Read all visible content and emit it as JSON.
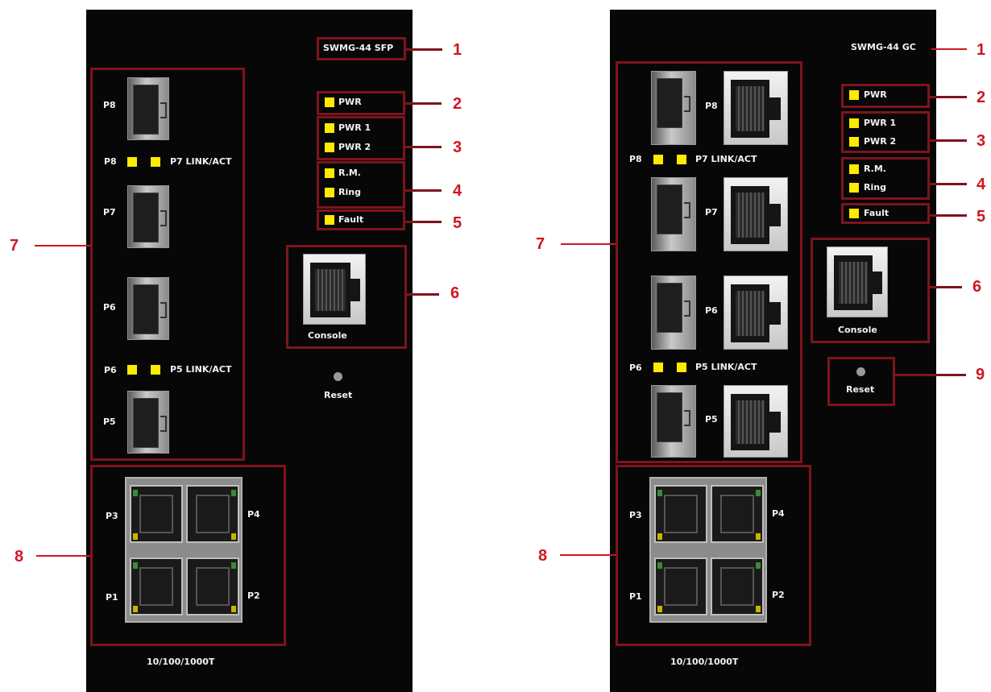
{
  "left_panel": {
    "model": "SWMG-44 SFP",
    "leds": {
      "pwr": "PWR",
      "pwr1": "PWR 1",
      "pwr2": "PWR 2",
      "rm": "R.M.",
      "ring": "Ring",
      "fault": "Fault"
    },
    "ports": {
      "p8": "P8",
      "p7": "P7",
      "p6": "P6",
      "p5": "P5",
      "p4": "P4",
      "p3": "P3",
      "p2": "P2",
      "p1": "P1"
    },
    "link_left_upper": "P8",
    "link_right_upper": "P7 LINK/ACT",
    "link_left_lower": "P6",
    "link_right_lower": "P5 LINK/ACT",
    "console": "Console",
    "reset": "Reset",
    "copper_label": "10/100/1000T"
  },
  "right_panel": {
    "model": "SWMG-44 GC",
    "leds": {
      "pwr": "PWR",
      "pwr1": "PWR 1",
      "pwr2": "PWR 2",
      "rm": "R.M.",
      "ring": "Ring",
      "fault": "Fault"
    },
    "ports": {
      "p8": "P8",
      "p7": "P7",
      "p6": "P6",
      "p5": "P5",
      "p4": "P4",
      "p3": "P3",
      "p2": "P2",
      "p1": "P1"
    },
    "link_left_upper": "P8",
    "link_right_upper": "P7 LINK/ACT",
    "link_left_lower": "P6",
    "link_right_lower": "P5 LINK/ACT",
    "console": "Console",
    "reset": "Reset",
    "copper_label": "10/100/1000T"
  },
  "callouts": [
    "1",
    "2",
    "3",
    "4",
    "5",
    "6",
    "7",
    "8",
    "9"
  ],
  "colors": {
    "panel": "#070707",
    "frame": "#7d141c",
    "callout": "#d01620",
    "led": "#ffea00"
  }
}
